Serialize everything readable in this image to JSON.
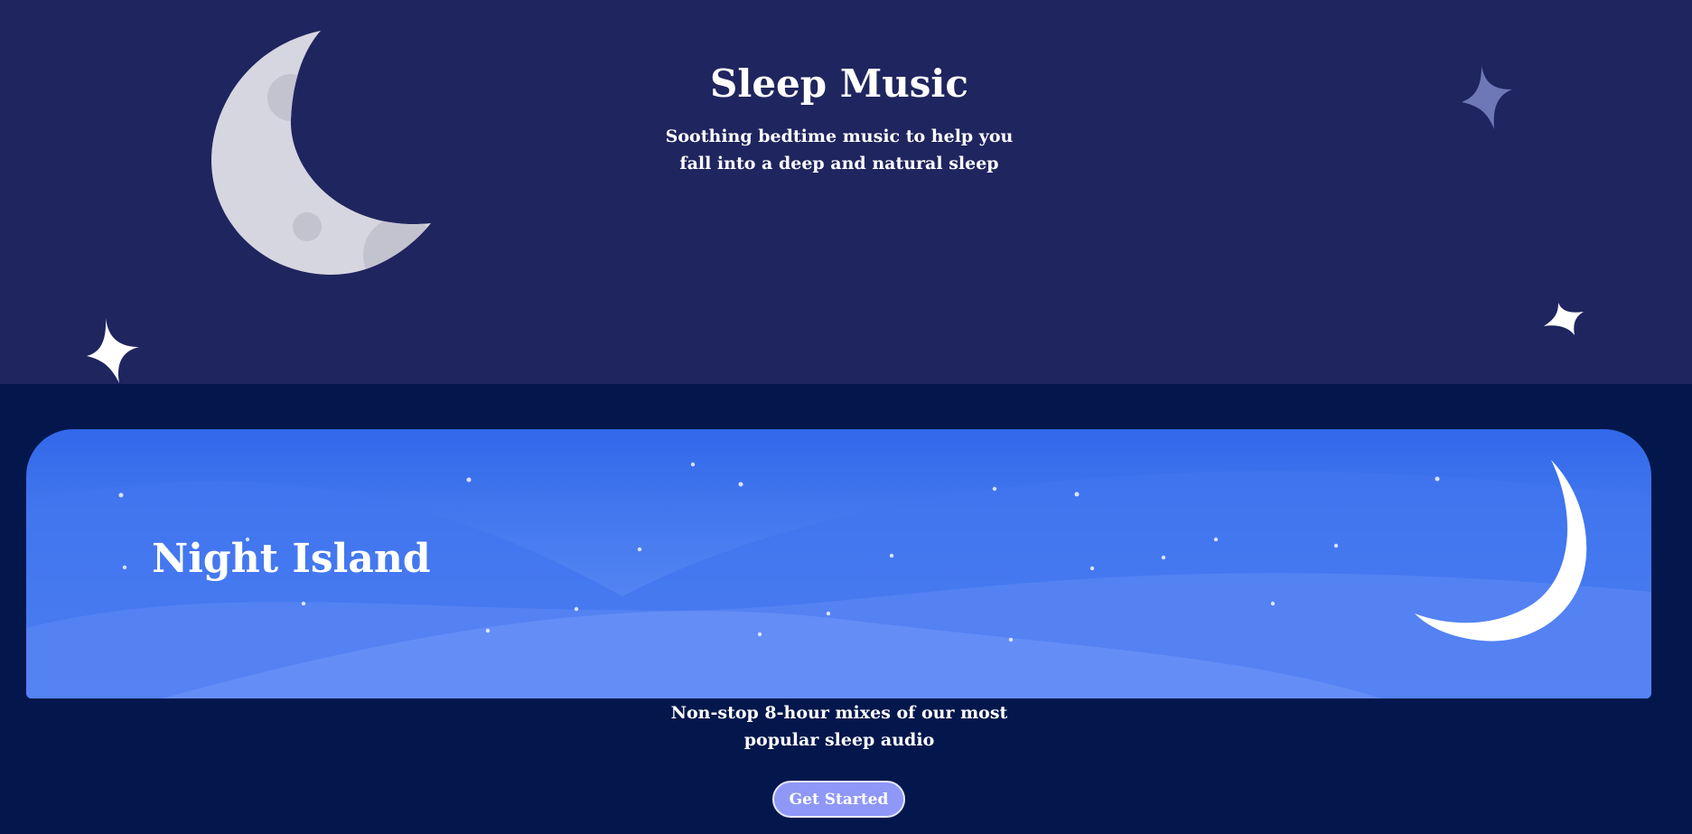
{
  "hero": {
    "title": "Sleep Music",
    "subtitle": "Soothing bedtime music to help you fall into a deep and natural sleep"
  },
  "feature": {
    "banner_title": "Night Island",
    "description": "Non-stop 8-hour mixes of our most popular sleep audio",
    "cta_label": "Get Started"
  },
  "colors": {
    "hero_background": "#1f255e",
    "page_background": "#03174c",
    "banner_blue": "#3d74ee",
    "button": "#8f98f6",
    "text": "#ffffff"
  },
  "icons": {
    "hero_moon": "crescent-moon-icon",
    "stars": "sparkle-star-icon",
    "banner_moon": "crescent-moon-icon"
  }
}
